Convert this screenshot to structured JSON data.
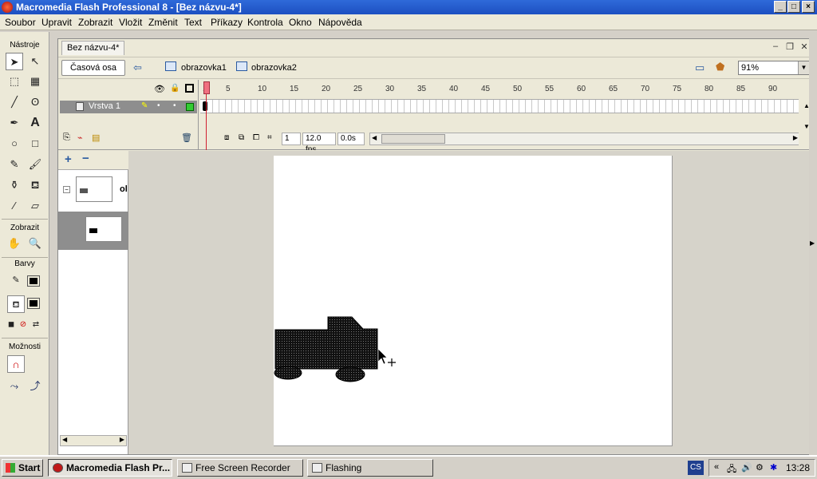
{
  "window": {
    "title": "Macromedia Flash Professional 8 - [Bez názvu-4*]",
    "minimize": "_",
    "maximize": "□",
    "close": "×"
  },
  "menu": [
    "Soubor",
    "Upravit",
    "Zobrazit",
    "Vložit",
    "Změnit",
    "Text",
    "Příkazy",
    "Kontrola",
    "Okno",
    "Nápověda"
  ],
  "toolbox": {
    "tools_heading": "Nástroje",
    "view_heading": "Zobrazit",
    "colors_heading": "Barvy",
    "options_heading": "Možnosti",
    "stroke_color": "#000000",
    "fill_color": "#000000"
  },
  "document": {
    "tab_title": "Bez názvu-4*",
    "timeline_button": "Časová osa",
    "breadcrumbs": [
      "obrazovka1",
      "obrazovka2"
    ],
    "zoom": "91%"
  },
  "timeline": {
    "layer_name": "Vrstva 1",
    "ruler": [
      "1",
      "5",
      "10",
      "15",
      "20",
      "25",
      "30",
      "35",
      "40",
      "45",
      "50",
      "55",
      "60",
      "65",
      "70",
      "75",
      "80",
      "85",
      "90"
    ],
    "current_frame": "1",
    "frame_rate": "12.0 fps",
    "elapsed_time": "0.0s"
  },
  "screens": {
    "parent_label": "ol"
  },
  "taskbar": {
    "start": "Start",
    "tasks": [
      "Macromedia Flash Pr...",
      "Free Screen Recorder",
      "Flashing"
    ],
    "language": "CS",
    "clock": "13:28"
  }
}
